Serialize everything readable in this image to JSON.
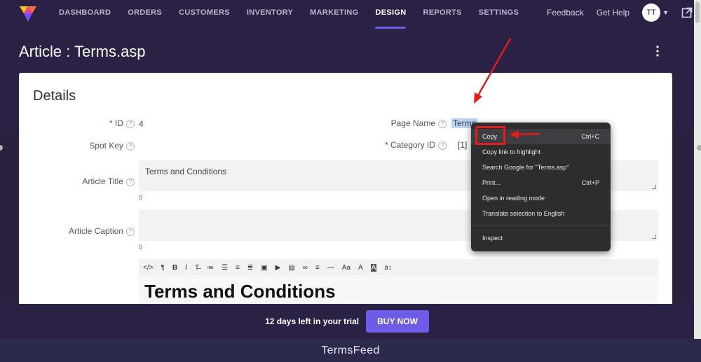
{
  "nav": {
    "items": [
      "DASHBOARD",
      "ORDERS",
      "CUSTOMERS",
      "INVENTORY",
      "MARKETING",
      "DESIGN",
      "REPORTS",
      "SETTINGS"
    ],
    "active": "DESIGN"
  },
  "header": {
    "feedback": "Feedback",
    "get_help": "Get Help",
    "avatar_initials": "TT",
    "page_title": "Article : Terms.asp"
  },
  "details": {
    "title": "Details",
    "id_label": "ID",
    "id_value": "4",
    "page_name_label": "Page Name",
    "page_name_value": "Terms",
    "spot_key_label": "Spot Key",
    "category_id_label": "Category ID",
    "category_id_value": "[1]",
    "article_title_label": "Article Title",
    "article_title_value": "Terms and Conditions",
    "article_title_count": "0",
    "article_caption_label": "Article Caption",
    "article_caption_value": "",
    "article_caption_count": "0",
    "editor_heading": "Terms and Conditions"
  },
  "toolbar": {
    "buttons": [
      "</>",
      "¶",
      "B",
      "I",
      "T̶",
      "≔",
      "☰",
      "≡",
      "≣",
      "▣",
      "▶",
      "▤",
      "∞",
      "≡",
      "—",
      "Aa",
      "A",
      "A",
      "a↕"
    ]
  },
  "context_menu": {
    "items": [
      {
        "label": "Copy",
        "shortcut": "Ctrl+C"
      },
      {
        "label": "Copy link to highlight",
        "shortcut": ""
      },
      {
        "label": "Search Google for \"Terms.asp\"",
        "shortcut": ""
      },
      {
        "label": "Print...",
        "shortcut": "Ctrl+P"
      },
      {
        "label": "Open in reading mode",
        "shortcut": ""
      },
      {
        "label": "Translate selection to English",
        "shortcut": ""
      },
      {
        "label": "Inspect",
        "shortcut": ""
      }
    ]
  },
  "trial": {
    "text": "12 days left in your trial",
    "button": "BUY NOW"
  },
  "footer": {
    "brand": "TermsFeed"
  },
  "colors": {
    "header_bg": "#2b2145",
    "accent": "#6c5ce7",
    "annotation_red": "#e21b1b"
  }
}
